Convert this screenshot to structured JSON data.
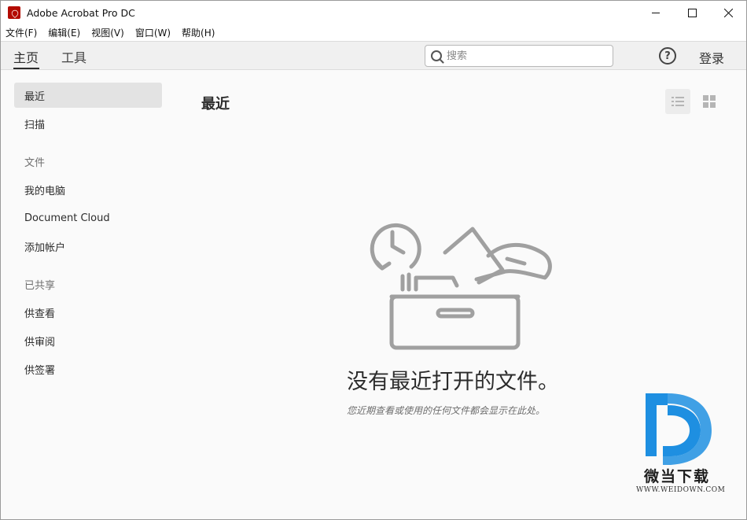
{
  "window": {
    "title": "Adobe Acrobat Pro DC",
    "controls": {
      "minimize": "—",
      "maximize": "☐",
      "close": "✕"
    }
  },
  "menubar": {
    "items": [
      {
        "label": "文件(F)"
      },
      {
        "label": "编辑(E)"
      },
      {
        "label": "视图(V)"
      },
      {
        "label": "窗口(W)"
      },
      {
        "label": "帮助(H)"
      }
    ]
  },
  "toolbar": {
    "tabs": [
      {
        "label": "主页",
        "active": true
      },
      {
        "label": "工具",
        "active": false
      }
    ],
    "search": {
      "placeholder": "搜索",
      "value": ""
    },
    "help_icon": "?",
    "signin_label": "登录"
  },
  "sidebar": {
    "items": [
      {
        "label": "最近",
        "active": true
      },
      {
        "label": "扫描"
      }
    ],
    "files_heading": "文件",
    "file_items": [
      {
        "label": "我的电脑"
      },
      {
        "label": "Document Cloud"
      },
      {
        "label": "添加帐户"
      }
    ],
    "shared_heading": "已共享",
    "shared_items": [
      {
        "label": "供查看"
      },
      {
        "label": "供审阅"
      },
      {
        "label": "供签署"
      }
    ]
  },
  "main": {
    "title": "最近",
    "view_modes": [
      "list-view-icon",
      "grid-view-icon"
    ],
    "empty_state": {
      "title": "没有最近打开的文件。",
      "subtitle": "您近期查看或使用的任何文件都会显示在此处。"
    }
  },
  "watermark": {
    "brand": "微当下载",
    "url": "WWW.WEIDOWN.COM",
    "accent_color": "#1e8fe1"
  },
  "colors": {
    "brand_red": "#b30b00",
    "sidebar_active": "#e3e3e3",
    "illustration_gray": "#a0a0a0"
  }
}
